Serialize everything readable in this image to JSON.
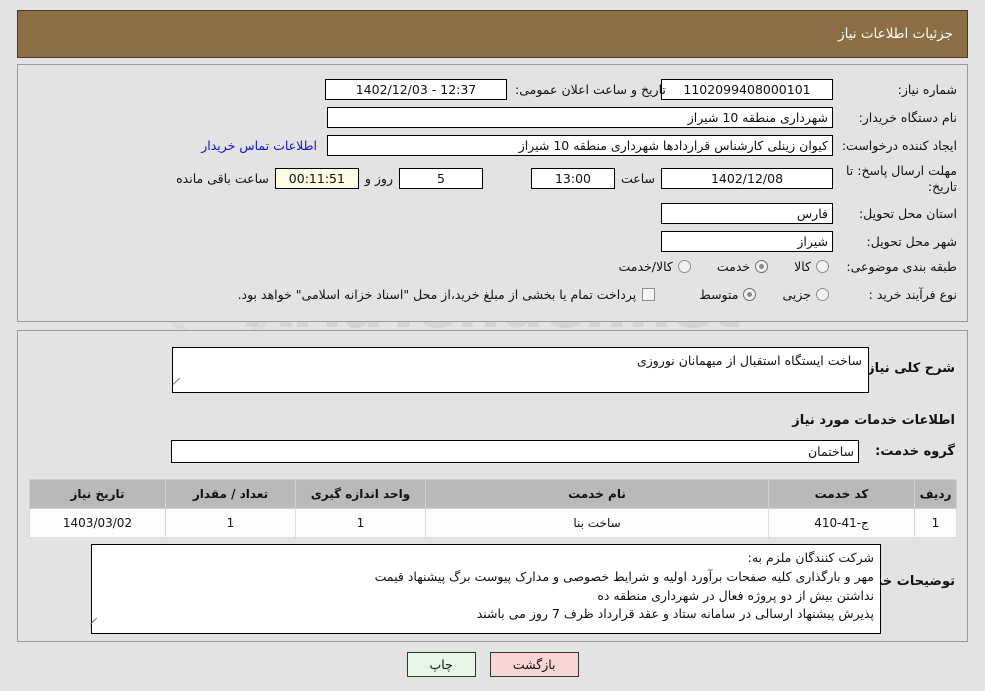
{
  "header": {
    "title": "جزئیات اطلاعات نیاز"
  },
  "form": {
    "need_number_label": "شماره نیاز:",
    "need_number_value": "1102099408000101",
    "announce_label": "تاریخ و ساعت اعلان عمومی:",
    "announce_value": "1402/12/03 - 12:37",
    "buyer_org_label": "نام دستگاه خریدار:",
    "buyer_org_value": "شهرداری منطقه 10 شیراز",
    "creator_label": "ایجاد کننده درخواست:",
    "creator_value": "کیوان زینلی کارشناس قراردادها شهرداری منطقه 10 شیراز",
    "contact_link": "اطلاعات تماس خریدار",
    "deadline_label": "مهلت ارسال پاسخ: تا تاریخ:",
    "deadline_date": "1402/12/08",
    "hour_label": "ساعت",
    "hour_value": "13:00",
    "days_value": "5",
    "days_label": "روز و",
    "countdown_value": "00:11:51",
    "countdown_label": "ساعت باقی مانده",
    "province_label": "استان محل تحویل:",
    "province_value": "فارس",
    "city_label": "شهر محل تحویل:",
    "city_value": "شیراز",
    "category_label": "طبقه بندی موضوعی:",
    "category_options": [
      {
        "label": "کالا",
        "selected": false
      },
      {
        "label": "خدمت",
        "selected": true
      },
      {
        "label": "کالا/خدمت",
        "selected": false
      }
    ],
    "process_label": "نوع فرآیند خرید :",
    "process_options": [
      {
        "label": "جزیی",
        "selected": false
      },
      {
        "label": "متوسط",
        "selected": true
      }
    ],
    "treasury_checkbox_label": "پرداخت تمام یا بخشی از مبلغ خرید،از محل \"اسناد خزانه اسلامی\" خواهد بود.",
    "treasury_checked": false
  },
  "need": {
    "summary_label": "شرح کلی نیاز:",
    "summary_value": "ساخت ایستگاه استقبال از میهمانان نوروزی",
    "services_section_title": "اطلاعات خدمات مورد نیاز",
    "service_group_label": "گروه خدمت:",
    "service_group_value": "ساختمان"
  },
  "table": {
    "columns": [
      "ردیف",
      "کد خدمت",
      "نام خدمت",
      "واحد اندازه گیری",
      "تعداد / مقدار",
      "تاریخ نیاز"
    ],
    "rows": [
      [
        "1",
        "ج-41-410",
        "ساخت بنا",
        "1",
        "1",
        "1403/03/02"
      ]
    ]
  },
  "notes": {
    "label": "توضیحات خریدار:",
    "value": "شرکت کنندگان ملزم به:\nمهر و بارگذاری کلیه صفحات برآورد اولیه و شرایط خصوصی و مدارک پیوست برگ پیشنهاد قیمت\nنداشتن بیش از دو پروژه فعال در شهرداری منطقه ده\nپذیرش پیشنهاد ارسالی در سامانه ستاد و عقد قرارداد ظرف 7 روز می باشند"
  },
  "buttons": {
    "print": "چاپ",
    "back": "بازگشت"
  },
  "watermark": {
    "text": "AriaTender.net"
  },
  "colors": {
    "header_brown": "#8c6e45",
    "page_bg": "#e3e3e3",
    "link_blue": "#1212dd",
    "table_header_gray": "#b9b9b9",
    "print_btn_green": "#e6f6e6",
    "back_btn_pink": "#fbd4d4",
    "countdown_bg": "#fdfde3"
  }
}
